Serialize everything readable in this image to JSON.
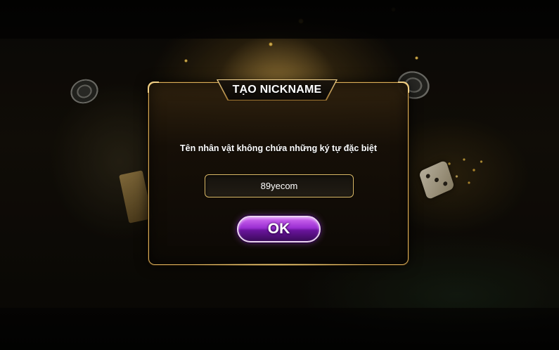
{
  "dialog": {
    "title": "TẠO NICKNAME",
    "message": "Tên nhân vật không chứa những ký tự đặc biệt",
    "nickname_input": {
      "value": "89yecom"
    },
    "ok_label": "OK"
  },
  "colors": {
    "dialog_border": "#d8ad5a",
    "button_purple": "#9a2fd1",
    "text": "#ffffff"
  }
}
